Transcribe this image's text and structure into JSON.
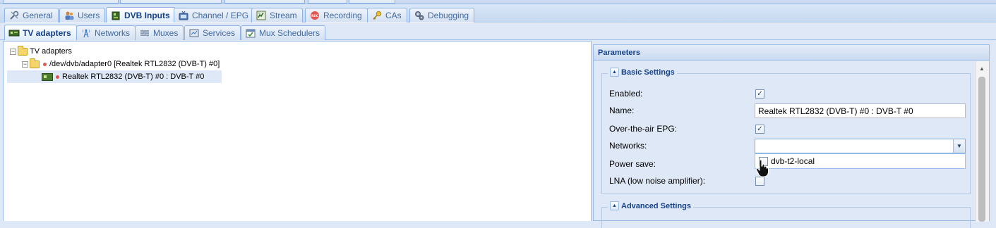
{
  "main_tabs": [
    {
      "label": "General",
      "icon": "wrench-icon"
    },
    {
      "label": "Users",
      "icon": "users-icon"
    },
    {
      "label": "DVB Inputs",
      "icon": "tv-card-icon"
    },
    {
      "label": "Channel / EPG",
      "icon": "tv-icon"
    },
    {
      "label": "Stream",
      "icon": "stream-icon"
    },
    {
      "label": "Recording",
      "icon": "rec-icon"
    },
    {
      "label": "CAs",
      "icon": "key-icon"
    },
    {
      "label": "Debugging",
      "icon": "gears-icon"
    }
  ],
  "sub_tabs": [
    {
      "label": "TV adapters",
      "icon": "tv-card-icon"
    },
    {
      "label": "Networks",
      "icon": "antenna-icon"
    },
    {
      "label": "Muxes",
      "icon": "muxes-icon"
    },
    {
      "label": "Services",
      "icon": "services-icon"
    },
    {
      "label": "Mux Schedulers",
      "icon": "calendar-icon"
    }
  ],
  "tree": {
    "root": "TV adapters",
    "adapter": "/dev/dvb/adapter0 [Realtek RTL2832 (DVB-T) #0]",
    "frontend": "Realtek RTL2832 (DVB-T) #0 : DVB-T #0"
  },
  "params": {
    "title": "Parameters",
    "basic_settings": "Basic Settings",
    "advanced_settings": "Advanced Settings",
    "fields": {
      "enabled": {
        "label": "Enabled:",
        "checked": true
      },
      "name": {
        "label": "Name:",
        "value": "Realtek RTL2832 (DVB-T) #0 : DVB-T #0"
      },
      "epg": {
        "label": "Over-the-air EPG:",
        "checked": true
      },
      "networks": {
        "label": "Networks:",
        "value": ""
      },
      "power_save": {
        "label": "Power save:"
      },
      "lna": {
        "label": "LNA (low noise amplifier):",
        "checked": false
      }
    },
    "networks_options": [
      {
        "label": "dvb-t2-local",
        "checked": false
      }
    ]
  },
  "colors": {
    "accent": "#15428b",
    "panel_bg": "#dfe8f6",
    "border": "#99bbe8",
    "rec": "#e3554f"
  }
}
